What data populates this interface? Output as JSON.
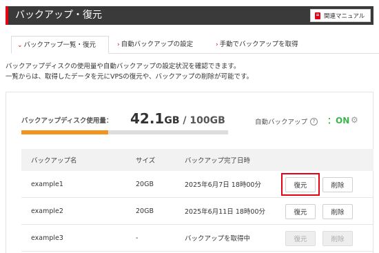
{
  "header": {
    "title": "バックアップ・復元",
    "manual_label": "関連マニュアル"
  },
  "tabs": [
    {
      "label": "バックアップ一覧・復元",
      "active": true
    },
    {
      "label": "自動バックアップの設定",
      "active": false
    },
    {
      "label": "手動でバックアップを取得",
      "active": false
    }
  ],
  "description": {
    "line1": "バックアップディスクの使用量や自動バックアップの設定状況を確認できます。",
    "line2": "一覧からは、取得したデータを元にVPSの復元や、バックアップの削除が可能です。"
  },
  "usage": {
    "label": "バックアップディスク使用量：",
    "used": "42.1",
    "used_unit": "GB",
    "total": " / 100GB",
    "fraction": 0.421
  },
  "auto_backup": {
    "label": "自動バックアップ",
    "help_icon": "?",
    "status": "：ON",
    "status_color": "#3bb54a"
  },
  "table": {
    "headers": {
      "name": "バックアップ名",
      "size": "サイズ",
      "date": "バックアップ完了日時"
    },
    "rows": [
      {
        "name": "example1",
        "size": "20GB",
        "date": "2025年6月7日 18時00分",
        "restore": "復元",
        "delete": "削除",
        "enabled": true,
        "highlighted": true
      },
      {
        "name": "example2",
        "size": "20GB",
        "date": "2025年6月11日 18時00分",
        "restore": "復元",
        "delete": "削除",
        "enabled": true,
        "highlighted": false
      },
      {
        "name": "example3",
        "size": "-",
        "date": "バックアップを取得中",
        "restore": "復元",
        "delete": "削除",
        "enabled": false,
        "highlighted": false
      }
    ]
  },
  "colors": {
    "accent": "#e60012",
    "header_bg": "#3a3a3a",
    "progress": "#f0931f"
  }
}
